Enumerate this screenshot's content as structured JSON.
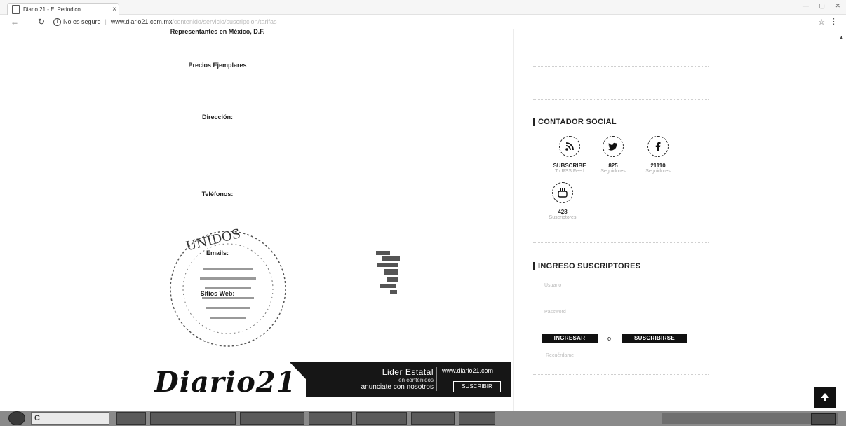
{
  "browser": {
    "tab_title": "Diario 21 - El Periodico",
    "tab_close": "×",
    "secure_label": "No es seguro",
    "url_host": "www.diario21.com.mx",
    "url_path": "/contenido/servicio/suscripcion/tarifas"
  },
  "left": {
    "rep_heading": "Representantes en México, D.F.",
    "rep_line": "",
    "prices_heading": "Precios Ejemplares",
    "prices_lines": [
      "",
      "",
      ""
    ],
    "address_heading": "Dirección:",
    "address_lines": [
      "",
      "",
      "",
      ""
    ],
    "phones_heading": "Teléfonos:",
    "phones_lines": [
      "",
      "",
      ""
    ],
    "emails_heading": "Emails:",
    "sites_heading": "Sitios Web:",
    "seal_text": "UNIDOS"
  },
  "banner": {
    "logo": "Diario21",
    "slogan_l1": "Lider Estatal",
    "slogan_l2": "en contenidos",
    "slogan_l3": "anunciate con nosotros",
    "site": "www.diario21.com",
    "button": "SUSCRIBIR"
  },
  "sidebar": {
    "contador_title": "CONTADOR SOCIAL",
    "social": [
      {
        "icon": "rss-icon",
        "count": "SUBSCRIBE",
        "sub": "To RSS Feed"
      },
      {
        "icon": "twitter-icon",
        "count": "825",
        "sub": "Seguidores"
      },
      {
        "icon": "facebook-icon",
        "count": "21110",
        "sub": "Seguidores"
      },
      {
        "icon": "youtube-icon",
        "count": "428",
        "sub": "Suscriptores"
      }
    ],
    "ingreso_title": "INGRESO SUSCRIPTORES",
    "user_placeholder": "Usuario",
    "pass_placeholder": "Password",
    "login_button": "INGRESAR",
    "or_text": "o",
    "subscribe_button": "SUSCRIBIRSE",
    "forgot_text": "Recuérdame"
  },
  "colors": {
    "accent": "#111111",
    "taskbar": "#8a8a8a"
  }
}
